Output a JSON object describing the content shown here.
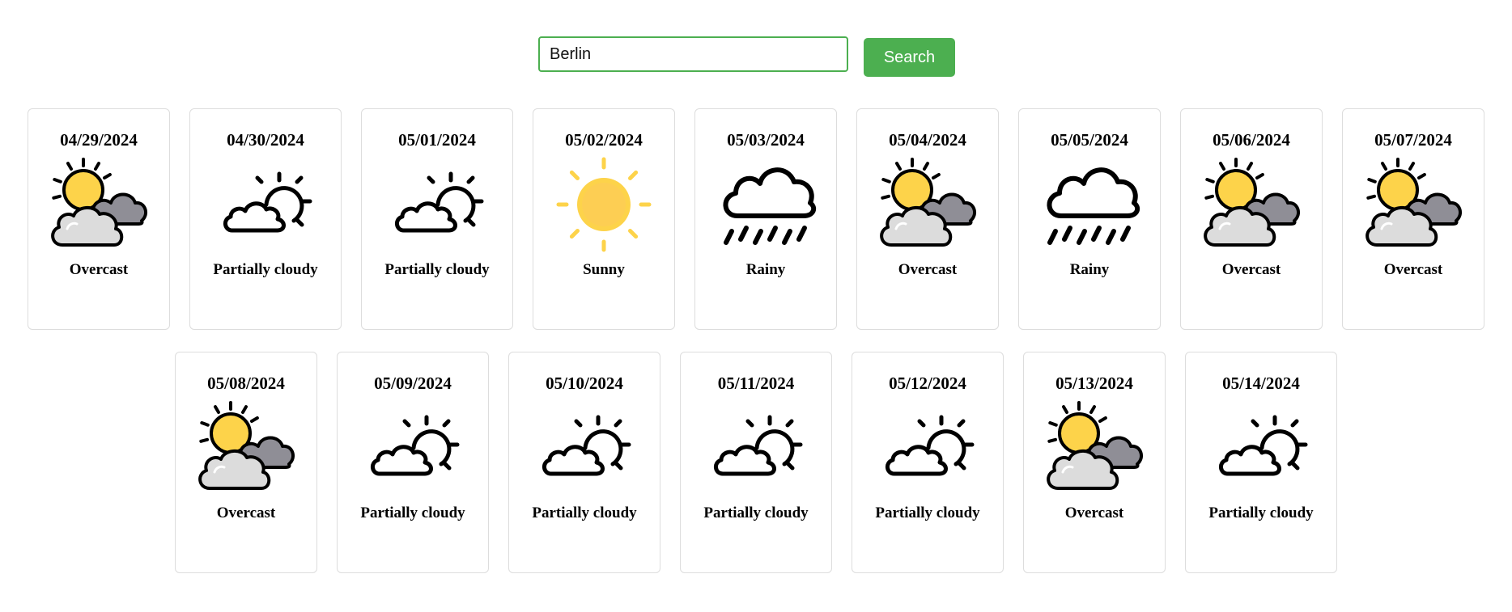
{
  "search": {
    "value": "Berlin",
    "button_label": "Search"
  },
  "colors": {
    "accent": "#4caf50",
    "sun": "#fdd34a",
    "cloud_dark": "#8f8e96",
    "cloud_light": "#dcdcdc"
  },
  "days": [
    {
      "date": "04/29/2024",
      "condition": "Overcast",
      "icon": "overcast-icon"
    },
    {
      "date": "04/30/2024",
      "condition": "Partially cloudy",
      "icon": "partly-cloudy-icon"
    },
    {
      "date": "05/01/2024",
      "condition": "Partially cloudy",
      "icon": "partly-cloudy-icon"
    },
    {
      "date": "05/02/2024",
      "condition": "Sunny",
      "icon": "sun-icon"
    },
    {
      "date": "05/03/2024",
      "condition": "Rainy",
      "icon": "rain-icon"
    },
    {
      "date": "05/04/2024",
      "condition": "Overcast",
      "icon": "overcast-icon"
    },
    {
      "date": "05/05/2024",
      "condition": "Rainy",
      "icon": "rain-icon"
    },
    {
      "date": "05/06/2024",
      "condition": "Overcast",
      "icon": "overcast-icon"
    },
    {
      "date": "05/07/2024",
      "condition": "Overcast",
      "icon": "overcast-icon"
    },
    {
      "date": "05/08/2024",
      "condition": "Overcast",
      "icon": "overcast-icon"
    },
    {
      "date": "05/09/2024",
      "condition": "Partially cloudy",
      "icon": "partly-cloudy-icon"
    },
    {
      "date": "05/10/2024",
      "condition": "Partially cloudy",
      "icon": "partly-cloudy-icon"
    },
    {
      "date": "05/11/2024",
      "condition": "Partially cloudy",
      "icon": "partly-cloudy-icon"
    },
    {
      "date": "05/12/2024",
      "condition": "Partially cloudy",
      "icon": "partly-cloudy-icon"
    },
    {
      "date": "05/13/2024",
      "condition": "Overcast",
      "icon": "overcast-icon"
    },
    {
      "date": "05/14/2024",
      "condition": "Partially cloudy",
      "icon": "partly-cloudy-icon"
    }
  ]
}
